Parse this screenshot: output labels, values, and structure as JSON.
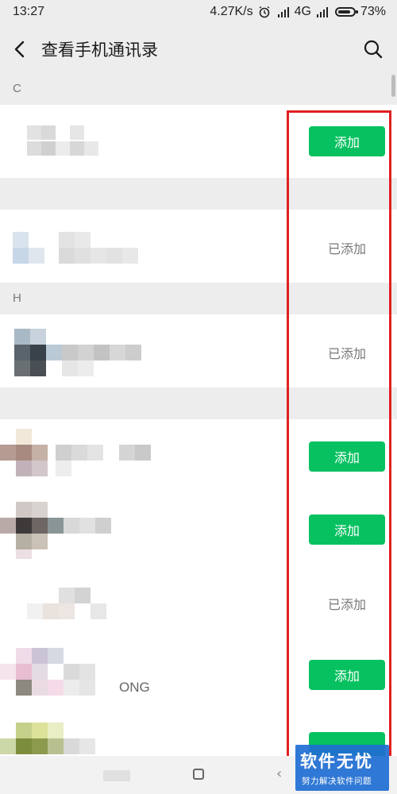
{
  "status_bar": {
    "time": "13:27",
    "speed": "4.27K/s",
    "network": "4G",
    "battery": "73%"
  },
  "header": {
    "title": "查看手机通讯录"
  },
  "sections": [
    "C",
    "H"
  ],
  "contacts": [
    {
      "action": "add",
      "label": "添加"
    },
    {
      "action": "added",
      "label": "已添加"
    },
    {
      "action": "added",
      "label": "已添加"
    },
    {
      "action": "add",
      "label": "添加"
    },
    {
      "action": "add",
      "label": "添加"
    },
    {
      "action": "added",
      "label": "已添加"
    },
    {
      "action": "add",
      "label": "添加",
      "name_fragment": "ONG"
    }
  ],
  "watermark": {
    "brand": "软件无忧",
    "tagline": "努力解决软件问题"
  },
  "colors": {
    "accent": "#07c160",
    "highlight": "#e02020",
    "watermark": "#206ed2"
  }
}
